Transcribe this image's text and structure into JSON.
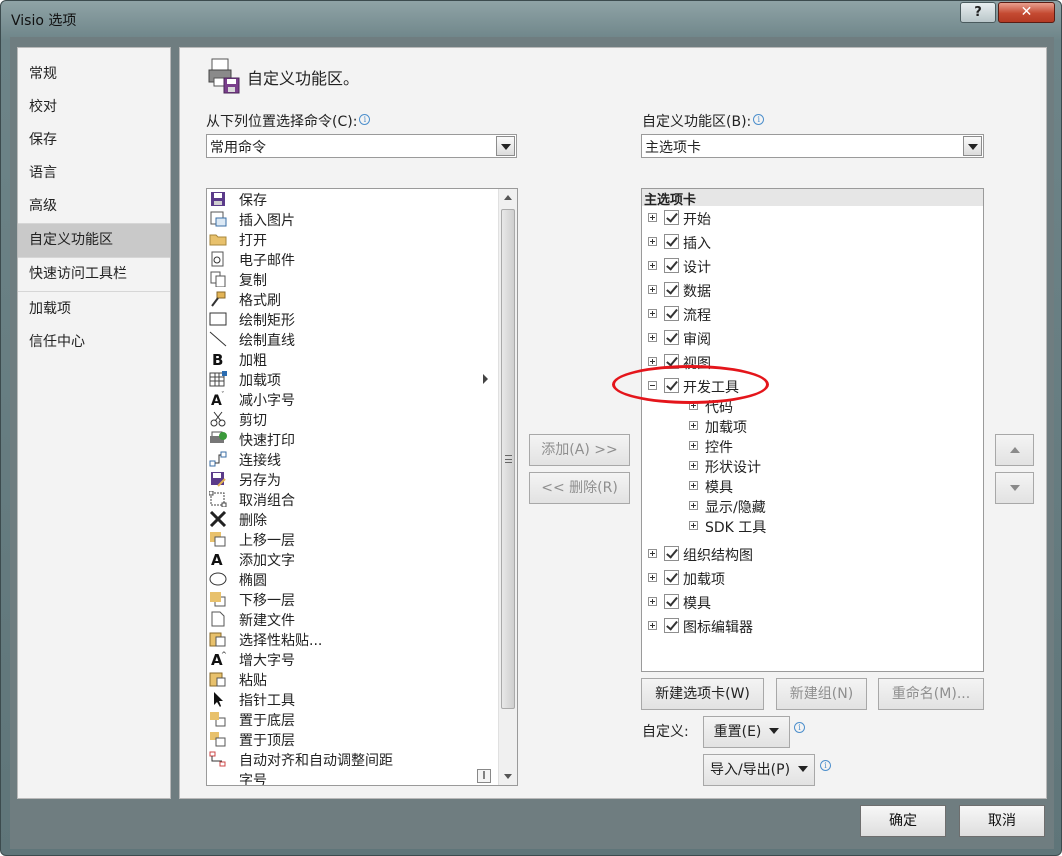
{
  "window": {
    "title": "Visio 选项",
    "help_label": "?",
    "close_label": "✕"
  },
  "nav": {
    "items": [
      {
        "label": "常规",
        "icon": "",
        "selected": false
      },
      {
        "label": "校对",
        "selected": false
      },
      {
        "label": "保存",
        "selected": false
      },
      {
        "label": "语言",
        "selected": false
      },
      {
        "label": "高级",
        "selected": false
      },
      {
        "label": "自定义功能区",
        "selected": true
      },
      {
        "label": "快速访问工具栏",
        "selected": false
      },
      {
        "label": "加载项",
        "selected": false
      },
      {
        "label": "信任中心",
        "selected": false
      }
    ]
  },
  "main": {
    "heading": "自定义功能区。",
    "choose_label": "从下列位置选择命令(C):",
    "choose_value": "常用命令",
    "customize_label": "自定义功能区(B):",
    "customize_value": "主选项卡",
    "info_symbol": "i",
    "commands": [
      {
        "label": "保存",
        "icon": "save-icon"
      },
      {
        "label": "插入图片",
        "icon": "insert-picture-icon"
      },
      {
        "label": "打开",
        "icon": "open-folder-icon"
      },
      {
        "label": "电子邮件",
        "icon": "email-icon"
      },
      {
        "label": "复制",
        "icon": "copy-icon"
      },
      {
        "label": "格式刷",
        "icon": "format-painter-icon"
      },
      {
        "label": "绘制矩形",
        "icon": "rectangle-icon"
      },
      {
        "label": "绘制直线",
        "icon": "line-icon"
      },
      {
        "label": "加粗",
        "icon": "bold-icon"
      },
      {
        "label": "加载项",
        "icon": "addins-icon",
        "submenu": true
      },
      {
        "label": "减小字号",
        "icon": "decrease-font-icon"
      },
      {
        "label": "剪切",
        "icon": "cut-icon"
      },
      {
        "label": "快速打印",
        "icon": "quick-print-icon"
      },
      {
        "label": "连接线",
        "icon": "connector-icon"
      },
      {
        "label": "另存为",
        "icon": "save-as-icon"
      },
      {
        "label": "取消组合",
        "icon": "ungroup-icon"
      },
      {
        "label": "删除",
        "icon": "delete-icon"
      },
      {
        "label": "上移一层",
        "icon": "bring-forward-icon"
      },
      {
        "label": "添加文字",
        "icon": "add-text-icon"
      },
      {
        "label": "椭圆",
        "icon": "ellipse-icon"
      },
      {
        "label": "下移一层",
        "icon": "send-backward-icon"
      },
      {
        "label": "新建文件",
        "icon": "new-file-icon"
      },
      {
        "label": "选择性粘贴...",
        "icon": "paste-special-icon"
      },
      {
        "label": "增大字号",
        "icon": "increase-font-icon"
      },
      {
        "label": "粘贴",
        "icon": "paste-icon"
      },
      {
        "label": "指针工具",
        "icon": "pointer-icon"
      },
      {
        "label": "置于底层",
        "icon": "send-to-back-icon"
      },
      {
        "label": "置于顶层",
        "icon": "bring-to-front-icon"
      },
      {
        "label": "自动对齐和自动调整间距",
        "icon": "auto-align-icon"
      },
      {
        "label": "字号",
        "icon": "font-size-icon"
      }
    ],
    "add_button": "添加(A) >>",
    "remove_button": "<< 删除(R)",
    "tree_header": "主选项卡",
    "tree": [
      {
        "label": "开始",
        "expanded": false,
        "checked": true
      },
      {
        "label": "插入",
        "expanded": false,
        "checked": true
      },
      {
        "label": "设计",
        "expanded": false,
        "checked": true
      },
      {
        "label": "数据",
        "expanded": false,
        "checked": true
      },
      {
        "label": "流程",
        "expanded": false,
        "checked": true
      },
      {
        "label": "审阅",
        "expanded": false,
        "checked": true
      },
      {
        "label": "视图",
        "expanded": false,
        "checked": true
      },
      {
        "label": "开发工具",
        "expanded": true,
        "checked": true,
        "children": [
          "代码",
          "加载项",
          "控件",
          "形状设计",
          "模具",
          "显示/隐藏",
          "SDK 工具"
        ]
      },
      {
        "label": "组织结构图",
        "expanded": false,
        "checked": true
      },
      {
        "label": "加载项",
        "expanded": false,
        "checked": true
      },
      {
        "label": "模具",
        "expanded": false,
        "checked": true
      },
      {
        "label": "图标编辑器",
        "expanded": false,
        "checked": true
      }
    ],
    "new_tab_button": "新建选项卡(W)",
    "new_group_button": "新建组(N)",
    "rename_button": "重命名(M)...",
    "customize_prefix": "自定义:",
    "reset_button": "重置(E)",
    "import_export_button": "导入/导出(P)"
  },
  "footer": {
    "ok_button": "确定",
    "cancel_button": "取消"
  },
  "colors": {
    "annotation": "#e4151b",
    "selected_nav": "#c9c9c9"
  }
}
